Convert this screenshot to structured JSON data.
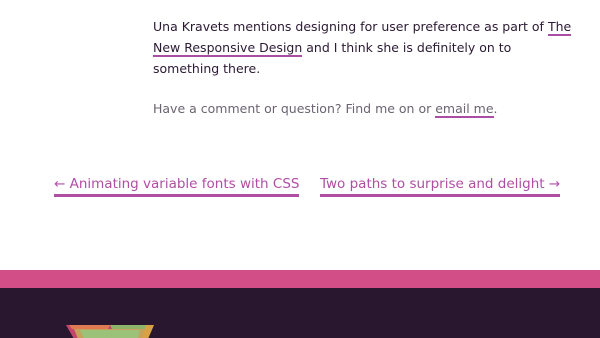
{
  "article": {
    "paragraph_before_link": "Una Kravets mentions designing for user preference as part of ",
    "paragraph_link": "The New Responsive Design",
    "paragraph_after_link": " and I think she is definitely on to something there."
  },
  "comment": {
    "prefix": "Have a comment or question? Find me on or ",
    "email_link": "email me",
    "suffix": "."
  },
  "post_nav": {
    "previous": "← Animating variable fonts with CSS",
    "next": "Two paths to surprise and delight →"
  },
  "colors": {
    "accent": "#b04ea4",
    "footer_stripe": "#d14f86",
    "footer_bg": "#29172f"
  }
}
